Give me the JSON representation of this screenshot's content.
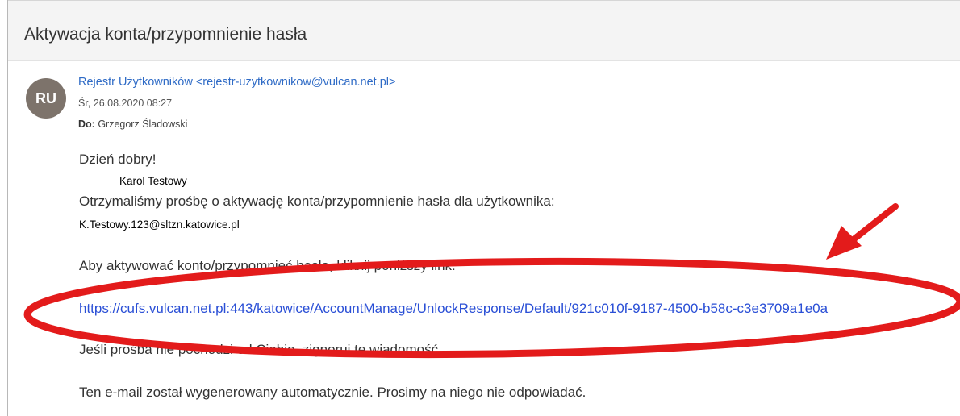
{
  "email": {
    "subject": "Aktywacja konta/przypomnienie hasła",
    "avatar_initials": "RU",
    "sender": "Rejestr Użytkowników <rejestr-uzytkownikow@vulcan.net.pl>",
    "date": "Śr, 26.08.2020 08:27",
    "to_label": "Do:",
    "to_value": "Grzegorz Śladowski",
    "greeting": "Dzień dobry!",
    "name_overlay": "Karol Testowy",
    "request_line": "Otrzymaliśmy prośbę o aktywację konta/przypomnienie hasła dla użytkownika:",
    "email_overlay": "K.Testowy.123@sltzn.katowice.pl",
    "instruction": "Aby aktywować konto/przypomnieć hasło, kliknij poniższy link:",
    "link": "https://cufs.vulcan.net.pl:443/katowice/AccountManage/UnlockResponse/Default/921c010f-9187-4500-b58c-c3e3709a1e0a",
    "ignore_line": "Jeśli prośba nie pochodzi od Ciebie, zignoruj tę wiadomość.",
    "footer": "Ten e-mail został wygenerowany automatycznie. Prosimy na niego nie odpowiadać."
  },
  "colors": {
    "link": "#2a4fd6",
    "sender": "#2f6bc6",
    "avatar_bg": "#7d736b",
    "annotation_red": "#e31b1b"
  }
}
